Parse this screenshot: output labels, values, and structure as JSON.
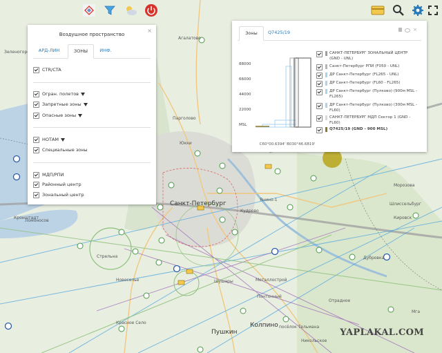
{
  "toolbar_left": {
    "icons": [
      "layers-icon",
      "filter-icon",
      "weather-icon",
      "power-icon"
    ],
    "colors": {
      "layers": "#f3f3f3",
      "filter": "#f3f3f3",
      "weather": "#f3f3f3",
      "power": "#d6342a"
    }
  },
  "toolbar_right": {
    "icons": [
      "card-icon",
      "search-icon",
      "settings-icon",
      "expand-icon"
    ],
    "colors": {
      "card": "#f2c94c",
      "search": "#f3f3f3",
      "settings": "#2a7ab8",
      "expand": "#f3f3f3"
    }
  },
  "airspace_panel": {
    "title": "Воздушное пространство",
    "close": "×",
    "tabs": [
      "АРД-ЛИН",
      "ЗОНЫ",
      "ИНФ."
    ],
    "active_tab": "ЗОНЫ",
    "items": [
      {
        "label": "CTR/CTA",
        "checked": true,
        "filter": false
      },
      {
        "label": "Огран. полетов",
        "checked": true,
        "filter": true
      },
      {
        "label": "Запретные зоны",
        "checked": true,
        "filter": true
      },
      {
        "label": "Опасные зоны",
        "checked": true,
        "filter": true
      },
      {
        "label": "НОТАМ",
        "checked": true,
        "filter": true
      },
      {
        "label": "Специальные зоны",
        "checked": true,
        "filter": false
      },
      {
        "label": "МДП/РПИ",
        "checked": true,
        "filter": false
      },
      {
        "label": "Районный центр",
        "checked": true,
        "filter": false
      },
      {
        "label": "Зональный центр",
        "checked": true,
        "filter": false
      }
    ]
  },
  "zones_panel": {
    "tabs": [
      "Зоны",
      "Q7425/19"
    ],
    "active_tab": "Зоны",
    "y_ticks": [
      "88000",
      "66000",
      "44000",
      "22000",
      "MSL"
    ],
    "coords": "C60°00.6394' В030°46.6819'",
    "zones": [
      {
        "label": "САНКТ-ПЕТЕРБУРГ ЗОНАЛЬНЫЙ ЦЕНТР (GND - UNL)",
        "color": "#9e9e9e",
        "bold": false
      },
      {
        "label": "Санкт-Петербург РПИ (F050 - UNL)",
        "color": "#b5b5b5",
        "bold": false
      },
      {
        "label": "ДР Санкт-Петербург (FL265 - UNL)",
        "color": "#a9d4f0",
        "bold": false
      },
      {
        "label": "ДР Санкт-Петербург (FL60 - FL265)",
        "color": "#a9d4f0",
        "bold": false
      },
      {
        "label": "ДР Санкт-Петербург (Пулково) (900м MSL - FL265)",
        "color": "#a9d4f0",
        "bold": false
      },
      {
        "label": "ДР Санкт-Петербург (Пулково) (300м MSL - FL60)",
        "color": "#a9d4f0",
        "bold": false
      },
      {
        "label": "САНКТ-ПЕТЕРБУРГ МДП Сектор 1 (GND - FL60)",
        "color": "#d9d9d9",
        "bold": false
      },
      {
        "label": "Q7425/19 (GND - 900 MSL)",
        "color": "#8a7a2a",
        "bold": true
      }
    ]
  },
  "map": {
    "places": [
      {
        "name": "Агалатово",
        "size": "small"
      },
      {
        "name": "Зеленогорск",
        "size": "small"
      },
      {
        "name": "Юкки",
        "size": "small"
      },
      {
        "name": "Парголово",
        "size": "small"
      },
      {
        "name": "Кронштадт",
        "size": "small"
      },
      {
        "name": "Ломоносов",
        "size": "small"
      },
      {
        "name": "Стрельна",
        "size": "small"
      },
      {
        "name": "Новоселье",
        "size": "small"
      },
      {
        "name": "Санкт-Петербург",
        "size": "big"
      },
      {
        "name": "Янино-1",
        "size": "small"
      },
      {
        "name": "Кудрово",
        "size": "small"
      },
      {
        "name": "Шушары",
        "size": "small"
      },
      {
        "name": "Металлострой",
        "size": "small"
      },
      {
        "name": "Понтонный",
        "size": "small"
      },
      {
        "name": "Колпино",
        "size": "small"
      },
      {
        "name": "Пушкин",
        "size": "small"
      },
      {
        "name": "Красное Село",
        "size": "small"
      },
      {
        "name": "Кировск",
        "size": "small"
      },
      {
        "name": "Шлиссельбург",
        "size": "small"
      },
      {
        "name": "Морозова",
        "size": "small"
      },
      {
        "name": "Дубровка",
        "size": "small"
      },
      {
        "name": "Отрадное",
        "size": "small"
      },
      {
        "name": "Мга",
        "size": "small"
      },
      {
        "name": "Никольское",
        "size": "small"
      },
      {
        "name": "посёлок Тельмана",
        "size": "small"
      }
    ]
  },
  "watermark": "YAPLAKAL.COM"
}
